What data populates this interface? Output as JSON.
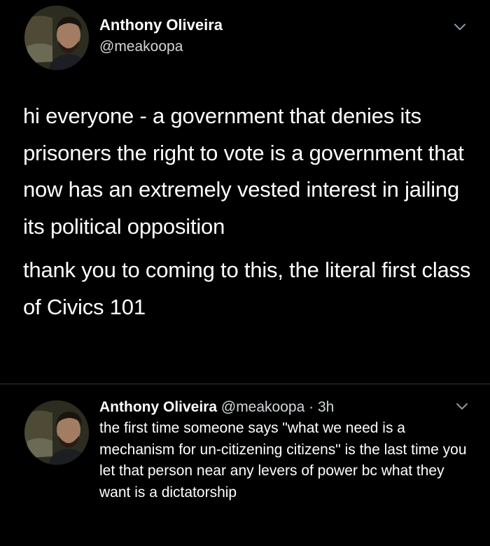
{
  "main_tweet": {
    "display_name": "Anthony Oliveira",
    "handle": "@meakoopa",
    "avatar_icon": "user-avatar",
    "menu_icon": "chevron-down-icon",
    "paragraphs": [
      "hi everyone - a government that denies its prisoners the right to vote is a government that now has an extremely vested interest in jailing its political opposition",
      "thank you to coming to this, the literal first class of Civics 101"
    ]
  },
  "reply_tweet": {
    "display_name": "Anthony Oliveira",
    "handle": "@meakoopa",
    "separator": "·",
    "time": "3h",
    "avatar_icon": "user-avatar",
    "menu_icon": "chevron-down-icon",
    "text": "the first time someone says \"what we need is a mechanism for un-citizening citizens\" is the last time you let that person near any levers of power bc what they want is a dictatorship"
  },
  "colors": {
    "background": "#000000",
    "text_primary": "#ffffff",
    "text_secondary": "#d3d6d9",
    "divider": "#2f3336",
    "chevron": "#8b98a5"
  }
}
